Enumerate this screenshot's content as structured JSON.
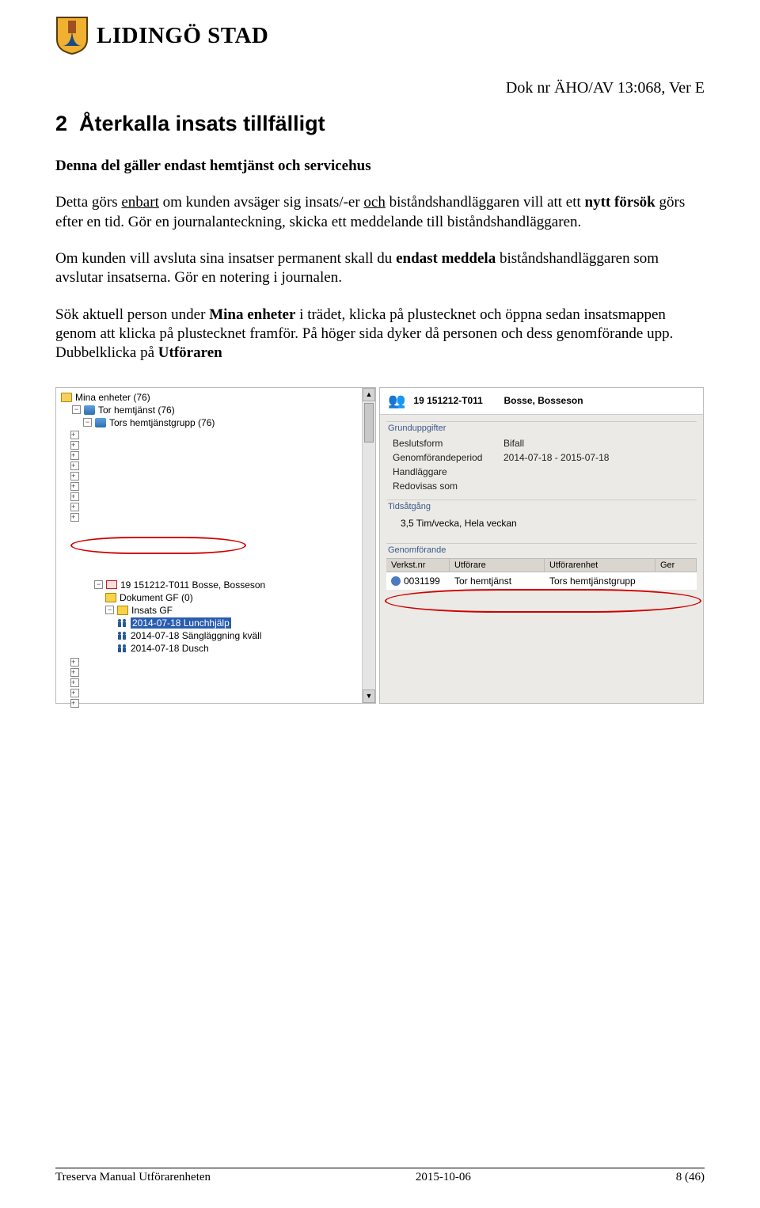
{
  "header": {
    "org_name": "LIDINGÖ STAD",
    "doc_reference": "Dok nr ÄHO/AV 13:068, Ver E"
  },
  "heading": {
    "number": "2",
    "title": "Återkalla insats tillfälligt"
  },
  "paragraphs": {
    "p1_a": "Denna del gäller endast hemtjänst och servicehus",
    "p2_a": "Detta görs ",
    "p2_b": "enbart",
    "p2_c": " om kunden avsäger sig insats/-er ",
    "p2_d": "och",
    "p2_e": " biståndshandläggaren vill att ett ",
    "p2_f": "nytt försök",
    "p2_g": " görs efter en tid. Gör en journalanteckning, skicka ett meddelande till biståndshandläggaren.",
    "p3_a": "Om kunden vill avsluta sina insatser permanent skall du ",
    "p3_b": "endast meddela",
    "p3_c": " biståndshandläggaren som avslutar insatserna. Gör en notering i journalen.",
    "p4_a": "Sök aktuell person under ",
    "p4_b": "Mina enheter",
    "p4_c": " i trädet, klicka på plustecknet och öppna sedan insatsmappen genom att klicka på plustecknet framför. På höger sida dyker då personen och dess genomförande upp. Dubbelklicka på ",
    "p4_d": "Utföraren"
  },
  "tree": {
    "root": "Mina enheter (76)",
    "n1": "Tor hemtjänst (76)",
    "n2": "Tors hemtjänstgrupp (76)",
    "person": "19 151212-T011 Bosse, Bosseson",
    "dokument": "Dokument GF (0)",
    "insats": "Insats GF",
    "i1": "2014-07-18 Lunchhjälp",
    "i2": "2014-07-18 Sängläggning kväll",
    "i3": "2014-07-18 Dusch"
  },
  "detail": {
    "person_id": "19 151212-T011",
    "person_name": "Bosse, Bosseson",
    "group1": "Grunduppgifter",
    "beslutsform_label": "Beslutsform",
    "beslutsform_value": "Bifall",
    "period_label": "Genomförandeperiod",
    "period_value": "2014-07-18 - 2015-07-18",
    "handlaggare_label": "Handläggare",
    "redovisas_label": "Redovisas som",
    "group2": "Tidsåtgång",
    "tids_value": "3,5 Tim/vecka, Hela veckan",
    "group3": "Genomförande",
    "th1": "Verkst.nr",
    "th2": "Utförare",
    "th3": "Utförarenhet",
    "th4": "Ger",
    "row_nr": "0031199",
    "row_utforare": "Tor hemtjänst",
    "row_enhet": "Tors hemtjänstgrupp"
  },
  "footer": {
    "left": "Treserva Manual Utförarenheten",
    "center": "2015-10-06",
    "right": "8 (46)"
  }
}
